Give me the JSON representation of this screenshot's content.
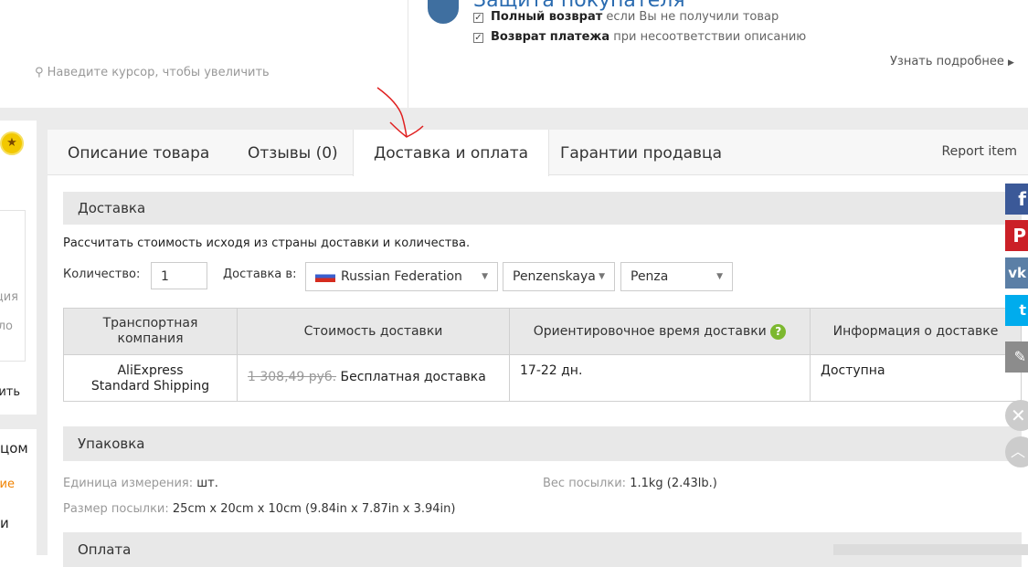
{
  "gallery": {
    "zoom_hint": "Наведите курсор, чтобы увеличить"
  },
  "protection": {
    "title": "Защита покупателя",
    "items": [
      {
        "bold": "Полный возврат",
        "text": " если Вы не получили товар"
      },
      {
        "bold": "Возврат платежа",
        "text": " при несоответствии описанию"
      }
    ],
    "more": "Узнать подробнее"
  },
  "left_sidebar": {
    "fragments": [
      "ция",
      "ло",
      "ить",
      "цом",
      "ие",
      "и"
    ],
    "accent_color": "#f08200"
  },
  "tabs": [
    {
      "label": "Описание товара"
    },
    {
      "label": "Отзывы (0)"
    },
    {
      "label": "Доставка и оплата",
      "active": true
    },
    {
      "label": "Гарантии продавца"
    }
  ],
  "report_item": "Report item",
  "shipping": {
    "title": "Доставка",
    "intro": "Рассчитать стоимость исходя из страны доставки и количества.",
    "quantity_label": "Количество:",
    "quantity": "1",
    "ship_to_label": "Доставка в:",
    "country": "Russian Federation",
    "region": "Penzenskaya",
    "city": "Penza",
    "columns": [
      "Транспортная компания",
      "Стоимость доставки",
      "Ориентировочное время доставки",
      "Информация о доставке"
    ],
    "rows": [
      {
        "company": "AliExpress Standard Shipping",
        "old_price": "1 308,49 руб.",
        "price": "Бесплатная доставка",
        "time": "17-22 дн.",
        "info": "Доступна"
      }
    ]
  },
  "packaging": {
    "title": "Упаковка",
    "unit_label": "Единица измерения:",
    "unit": "шт.",
    "weight_label": "Вес посылки:",
    "weight": "1.1kg (2.43lb.)",
    "size_label": "Размер посылки:",
    "size": "25cm x 20cm x 10cm (9.84in x 7.87in x 3.94in)"
  },
  "payment": {
    "title": "Оплата"
  },
  "share": [
    {
      "icon": "facebook-icon",
      "color": "#3b5998"
    },
    {
      "icon": "pinterest-icon",
      "color": "#cb2027"
    },
    {
      "icon": "vk-icon",
      "color": "#5b7fa6"
    },
    {
      "icon": "twitter-icon",
      "color": "#00aced"
    },
    {
      "icon": "edit-icon",
      "color": "#8c8c8c"
    }
  ]
}
